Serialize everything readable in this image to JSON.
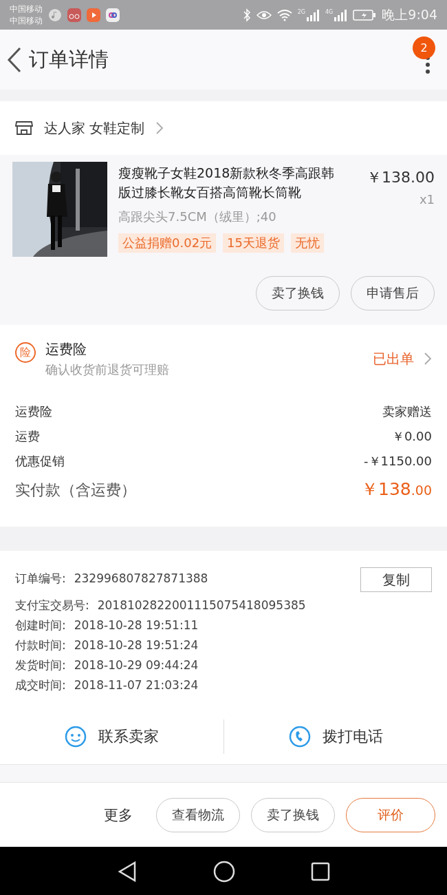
{
  "status_bar": {
    "carriers": [
      "中国移动",
      "中国移动"
    ],
    "networks": [
      "2G",
      "4G"
    ],
    "time": "晚上9:04"
  },
  "header": {
    "title": "订单详情",
    "badge": "2"
  },
  "shop": {
    "name": "达人家 女鞋定制"
  },
  "product": {
    "kind": "picture",
    "title": "瘦瘦靴子女鞋2018新款秋冬季高跟韩版过膝长靴女百搭高筒靴长筒靴",
    "sku": "高跟尖头7.5CM（绒里）;40",
    "price": "￥138.00",
    "quantity": "x1",
    "tags": [
      "公益捐赠0.02元",
      "15天退货",
      "无忧"
    ],
    "actions": [
      "卖了换钱",
      "申请售后"
    ]
  },
  "insurance": {
    "icon_label": "险",
    "title": "运费险",
    "subtitle": "确认收货前退货可理赔",
    "status": "已出单"
  },
  "fees": [
    {
      "label": "运费险",
      "value": "卖家赠送"
    },
    {
      "label": "运费",
      "value": "￥0.00"
    },
    {
      "label": "优惠促销",
      "value": "-￥1150.00"
    }
  ],
  "total": {
    "label": "实付款（含运费）",
    "integer": "￥138",
    "decimal": ".00"
  },
  "order_info": {
    "copy_button": "复制",
    "rows": [
      {
        "label": "订单编号:",
        "value": "232996807827871388"
      },
      {
        "label": "支付宝交易号:",
        "value": "2018102822001115075418095385"
      },
      {
        "label": "创建时间:",
        "value": "2018-10-28 19:51:11"
      },
      {
        "label": "付款时间:",
        "value": "2018-10-28 19:51:24"
      },
      {
        "label": "发货时间:",
        "value": "2018-10-29 09:44:24"
      },
      {
        "label": "成交时间:",
        "value": "2018-11-07 21:03:24"
      }
    ]
  },
  "contact": [
    "联系卖家",
    "拨打电话"
  ],
  "bottom_bar": {
    "more": "更多",
    "buttons": [
      {
        "label": "查看物流",
        "kind": "plain"
      },
      {
        "label": "卖了换钱",
        "kind": "plain"
      },
      {
        "label": "评价",
        "kind": "primary"
      }
    ]
  }
}
